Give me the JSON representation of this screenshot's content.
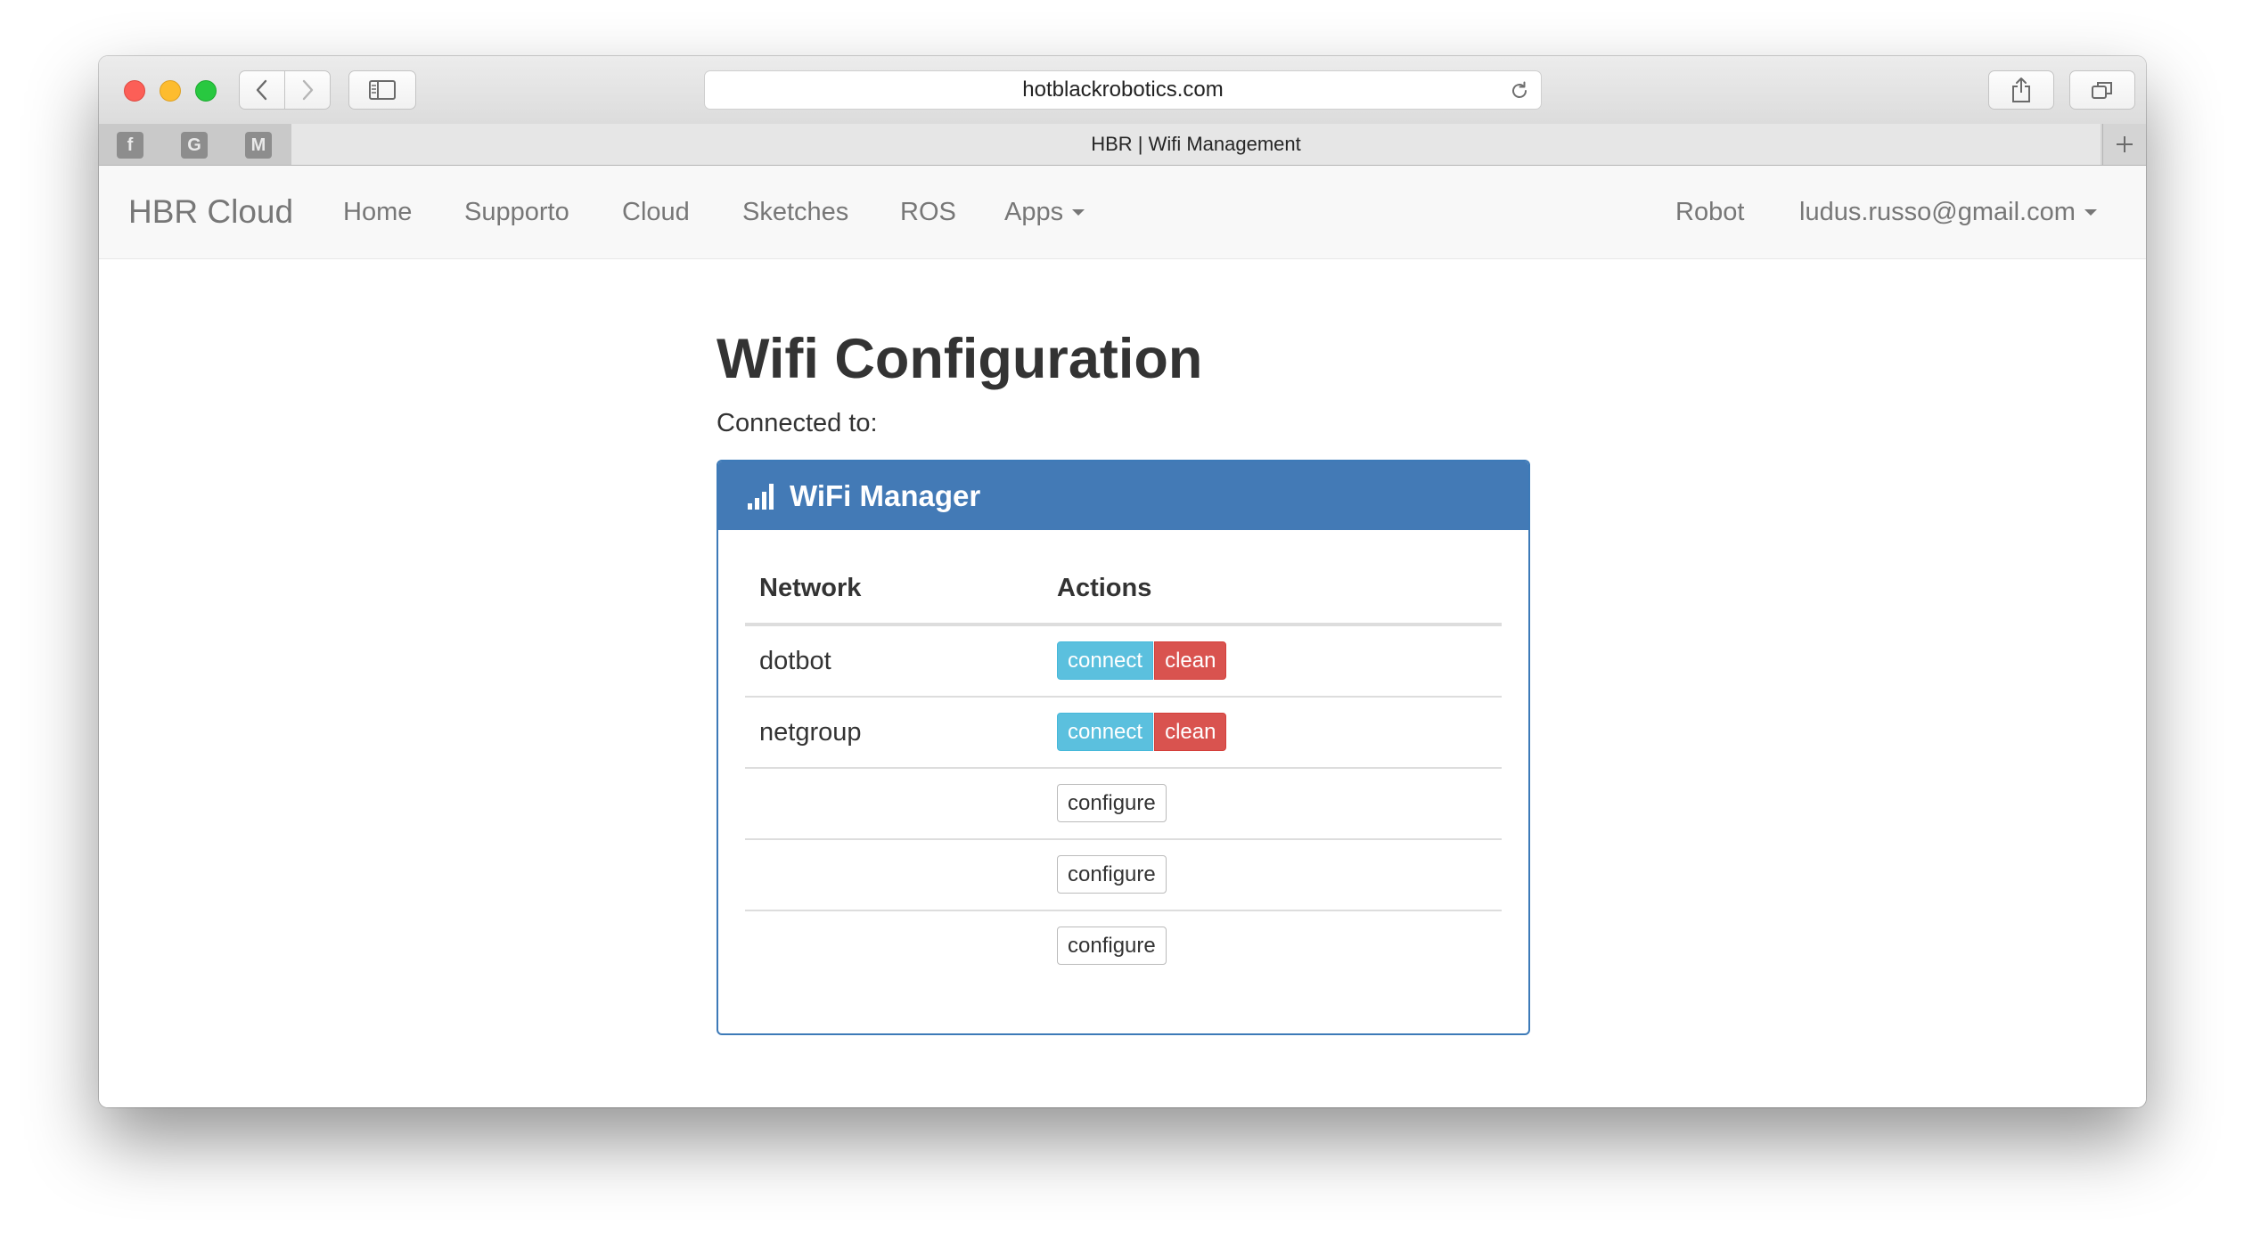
{
  "browser": {
    "url": "hotblackrobotics.com",
    "tab_title": "HBR | Wifi Management",
    "favorites": [
      "f",
      "G",
      "M"
    ]
  },
  "navbar": {
    "brand": "HBR Cloud",
    "items": [
      "Home",
      "Supporto",
      "Cloud",
      "Sketches",
      "ROS",
      "Apps"
    ],
    "right_items": [
      "Robot",
      "ludus.russo@gmail.com"
    ]
  },
  "page": {
    "title": "Wifi Configuration",
    "connected_label": "Connected to:"
  },
  "panel": {
    "title": "WiFi Manager",
    "columns": [
      "Network",
      "Actions"
    ],
    "rows": [
      {
        "network": "dotbot",
        "actions": [
          "connect",
          "clean"
        ]
      },
      {
        "network": "netgroup",
        "actions": [
          "connect",
          "clean"
        ]
      },
      {
        "network": "",
        "actions": [
          "configure"
        ]
      },
      {
        "network": "",
        "actions": [
          "configure"
        ]
      },
      {
        "network": "",
        "actions": [
          "configure"
        ]
      }
    ]
  },
  "colors": {
    "panel_primary": "#437ab6",
    "btn_info": "#5bc0de",
    "btn_danger": "#d9534f",
    "navbar_bg": "#f8f8f8"
  }
}
